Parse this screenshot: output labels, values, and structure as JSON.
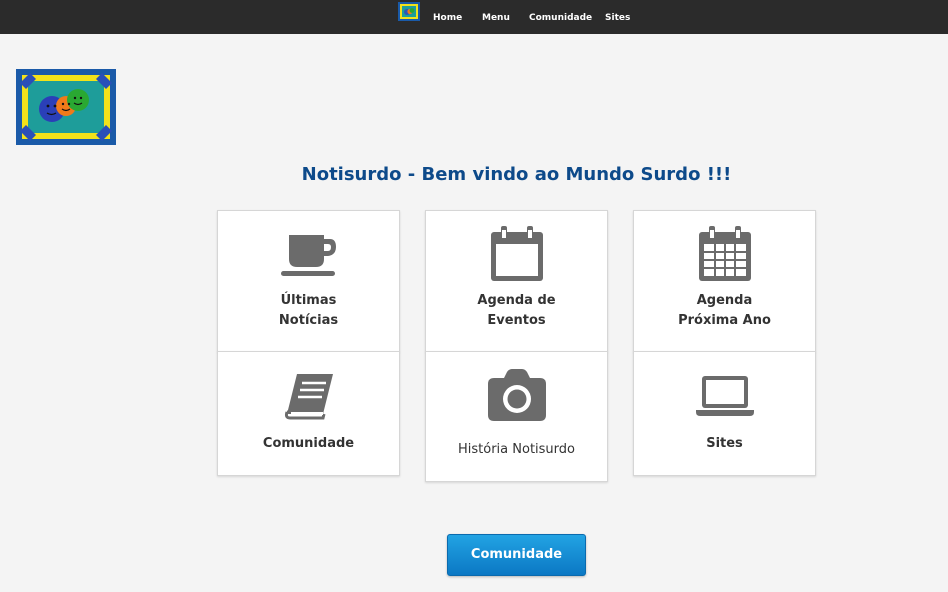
{
  "nav": {
    "items": [
      {
        "label": "Home"
      },
      {
        "label": "Menu"
      },
      {
        "label": "Comunidade"
      },
      {
        "label": "Sites"
      }
    ]
  },
  "page": {
    "title": "Notisurdo - Bem vindo ao Mundo Surdo !!!"
  },
  "cards": [
    {
      "lines": [
        "Últimas",
        "Notícias"
      ],
      "icon": "coffee-cup-icon"
    },
    {
      "lines": [
        "Agenda de",
        "Eventos"
      ],
      "icon": "calendar-icon"
    },
    {
      "lines": [
        "Agenda",
        "Próxima Ano"
      ],
      "icon": "calendar-grid-icon"
    },
    {
      "lines": [
        "Comunidade"
      ],
      "icon": "book-icon"
    },
    {
      "lines": [
        "História Notisurdo"
      ],
      "icon": "camera-icon"
    },
    {
      "lines": [
        "Sites"
      ],
      "icon": "laptop-icon"
    }
  ],
  "button": {
    "label": "Comunidade"
  },
  "colors": {
    "topbar": "#2b2b2b",
    "title": "#0d4a8a",
    "icon": "#6b6b6b",
    "button": "#1590d6",
    "logo_border": "#1a5aa8",
    "logo_yellow": "#f2e21a",
    "logo_teal": "#1e9d9a"
  }
}
